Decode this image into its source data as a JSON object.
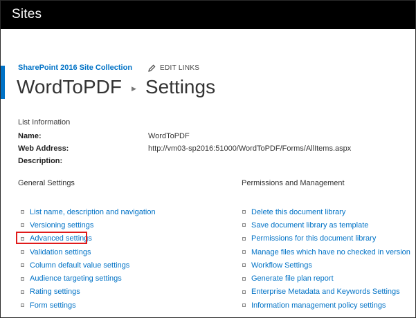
{
  "suite_bar": {
    "title": "Sites"
  },
  "header": {
    "site_collection": "SharePoint 2016 Site Collection",
    "edit_links": "EDIT LINKS",
    "breadcrumb": {
      "list_name": "WordToPDF",
      "page": "Settings"
    }
  },
  "list_information": {
    "heading": "List Information",
    "name_label": "Name:",
    "name_value": "WordToPDF",
    "web_address_label": "Web Address:",
    "web_address_value": "http://vm03-sp2016:51000/WordToPDF/Forms/AllItems.aspx",
    "description_label": "Description:"
  },
  "general_settings": {
    "heading": "General Settings",
    "items": [
      "List name, description and navigation",
      "Versioning settings",
      "Advanced settings",
      "Validation settings",
      "Column default value settings",
      "Audience targeting settings",
      "Rating settings",
      "Form settings"
    ]
  },
  "permissions_management": {
    "heading": "Permissions and Management",
    "items": [
      "Delete this document library",
      "Save document library as template",
      "Permissions for this document library",
      "Manage files which have no checked in version",
      "Workflow Settings",
      "Generate file plan report",
      "Enterprise Metadata and Keywords Settings",
      "Information management policy settings"
    ]
  },
  "colors": {
    "accent": "#0072c6",
    "suite_bar": "#000000",
    "highlight": "#e01b1b"
  }
}
